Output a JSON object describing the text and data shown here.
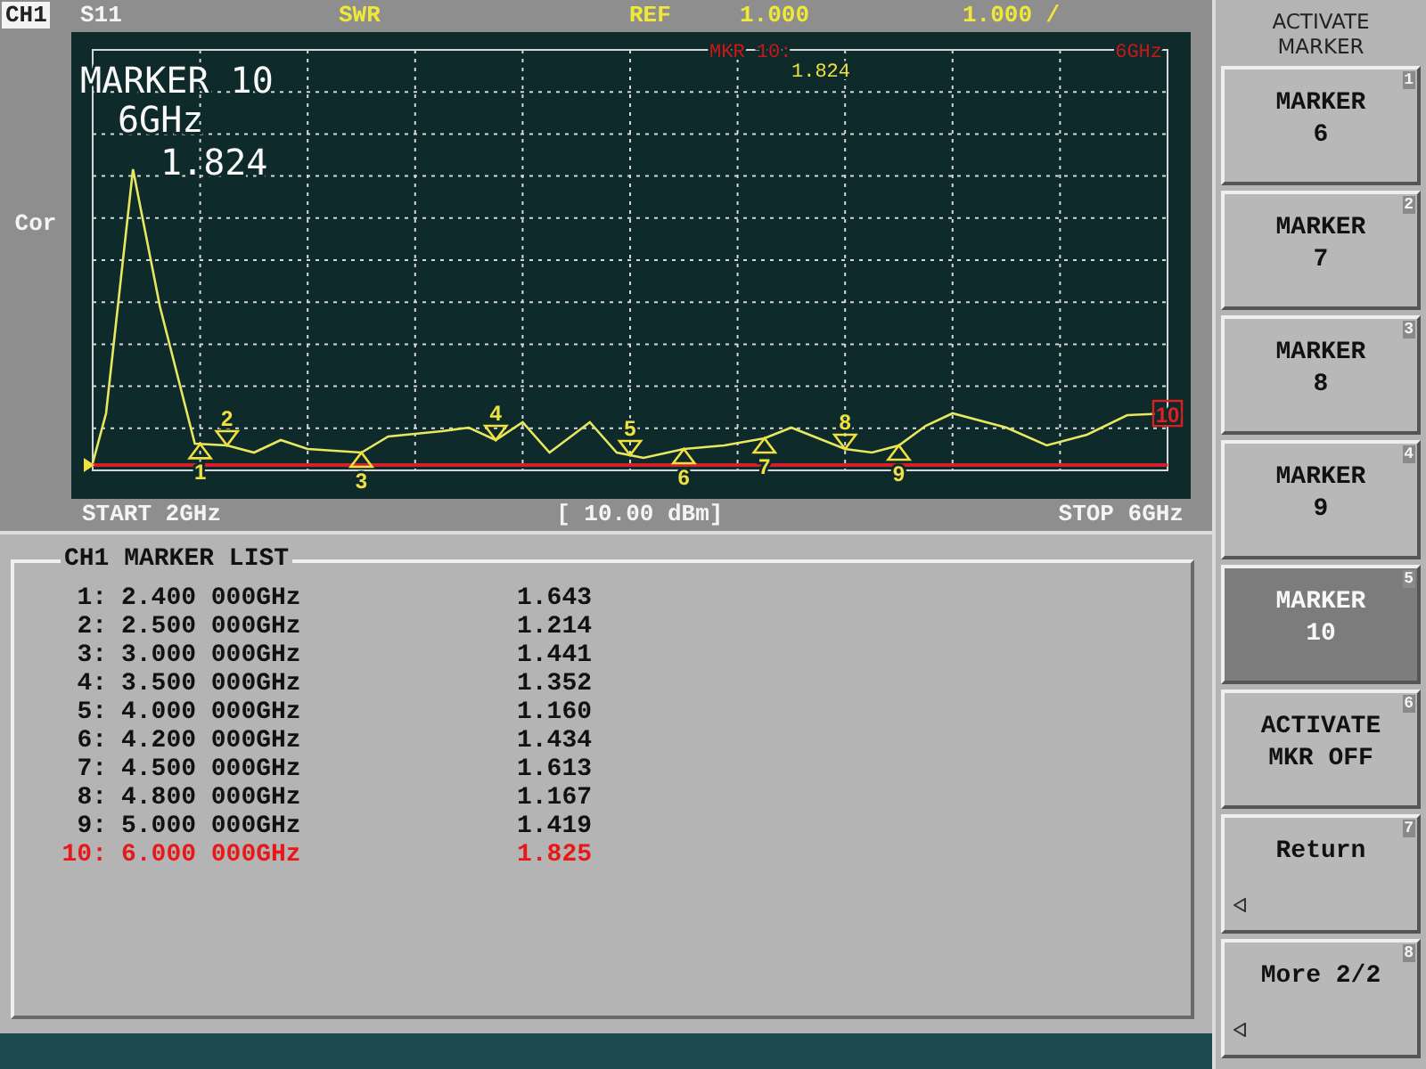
{
  "header": {
    "channel": "CH1",
    "parameter": "S11",
    "format": "SWR",
    "ref_label": "REF",
    "ref_value": "1.000",
    "scale": "1.000 /"
  },
  "plot": {
    "side_label": "Cor",
    "readout": {
      "title": "MARKER 10",
      "frequency": "6GHz",
      "value": "1.824"
    },
    "marker_annotation": {
      "label": "MKR 10:",
      "value": "1.824",
      "frequency": "6GHz"
    },
    "markers": [
      {
        "label": "1",
        "kind": "up"
      },
      {
        "label": "2",
        "kind": "down"
      },
      {
        "label": "3",
        "kind": "up"
      },
      {
        "label": "4",
        "kind": "down"
      },
      {
        "label": "5",
        "kind": "down"
      },
      {
        "label": "6",
        "kind": "up"
      },
      {
        "label": "7",
        "kind": "up"
      },
      {
        "label": "8",
        "kind": "down"
      },
      {
        "label": "9",
        "kind": "up"
      },
      {
        "label": "10",
        "kind": "boxed"
      }
    ],
    "start": "START 2GHz",
    "power": "[ 10.00 dBm]",
    "stop": "STOP 6GHz"
  },
  "marker_list": {
    "title": "CH1 MARKER LIST",
    "rows": [
      {
        "index": "1:",
        "frequency": "2.400 000GHz",
        "value": "1.643",
        "active": false
      },
      {
        "index": "2:",
        "frequency": "2.500 000GHz",
        "value": "1.214",
        "active": false
      },
      {
        "index": "3:",
        "frequency": "3.000 000GHz",
        "value": "1.441",
        "active": false
      },
      {
        "index": "4:",
        "frequency": "3.500 000GHz",
        "value": "1.352",
        "active": false
      },
      {
        "index": "5:",
        "frequency": "4.000 000GHz",
        "value": "1.160",
        "active": false
      },
      {
        "index": "6:",
        "frequency": "4.200 000GHz",
        "value": "1.434",
        "active": false
      },
      {
        "index": "7:",
        "frequency": "4.500 000GHz",
        "value": "1.613",
        "active": false
      },
      {
        "index": "8:",
        "frequency": "4.800 000GHz",
        "value": "1.167",
        "active": false
      },
      {
        "index": "9:",
        "frequency": "5.000 000GHz",
        "value": "1.419",
        "active": false
      },
      {
        "index": "10:",
        "frequency": "6.000 000GHz",
        "value": "1.825",
        "active": true
      }
    ]
  },
  "softkeys": {
    "title": [
      "ACTIVATE",
      "MARKER"
    ],
    "keys": [
      {
        "lines": [
          "MARKER",
          "6"
        ],
        "number": "1",
        "selected": false,
        "arrow": false
      },
      {
        "lines": [
          "MARKER",
          "7"
        ],
        "number": "2",
        "selected": false,
        "arrow": false
      },
      {
        "lines": [
          "MARKER",
          "8"
        ],
        "number": "3",
        "selected": false,
        "arrow": false
      },
      {
        "lines": [
          "MARKER",
          "9"
        ],
        "number": "4",
        "selected": false,
        "arrow": false
      },
      {
        "lines": [
          "MARKER",
          "10"
        ],
        "number": "5",
        "selected": true,
        "arrow": false
      },
      {
        "lines": [
          "ACTIVATE",
          "MKR OFF"
        ],
        "number": "6",
        "selected": false,
        "arrow": false
      },
      {
        "lines": [
          "Return"
        ],
        "number": "7",
        "selected": false,
        "arrow": true
      },
      {
        "lines": [
          "More 2/2"
        ],
        "number": "8",
        "selected": false,
        "arrow": true
      }
    ]
  }
}
